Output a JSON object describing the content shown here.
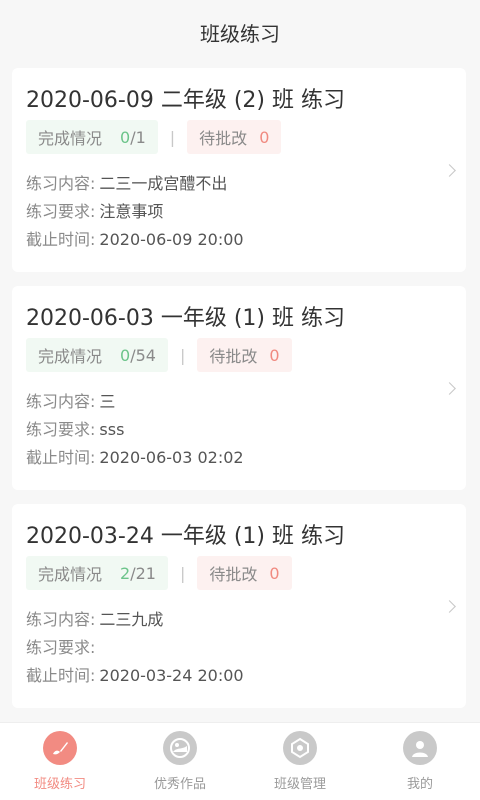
{
  "header": {
    "title": "班级练习"
  },
  "cards": [
    {
      "title": "2020-06-09 二年级 (2) 班 练习",
      "done_label": "完成情况",
      "done_count": "0",
      "done_total": "/1",
      "pending_label": "待批改",
      "pending_count": "0",
      "content_label": "练习内容:",
      "content_value": "二三一成宫醴不出",
      "require_label": "练习要求:",
      "require_value": "注意事项",
      "deadline_label": "截止时间:",
      "deadline_value": "2020-06-09 20:00"
    },
    {
      "title": "2020-06-03 一年级 (1) 班 练习",
      "done_label": "完成情况",
      "done_count": "0",
      "done_total": "/54",
      "pending_label": "待批改",
      "pending_count": "0",
      "content_label": "练习内容:",
      "content_value": "三",
      "require_label": "练习要求:",
      "require_value": "sss",
      "deadline_label": "截止时间:",
      "deadline_value": "2020-06-03 02:02"
    },
    {
      "title": "2020-03-24 一年级 (1) 班 练习",
      "done_label": "完成情况",
      "done_count": "2",
      "done_total": "/21",
      "pending_label": "待批改",
      "pending_count": "0",
      "content_label": "练习内容:",
      "content_value": "二三九成",
      "require_label": "练习要求:",
      "require_value": "",
      "deadline_label": "截止时间:",
      "deadline_value": "2020-03-24 20:00"
    }
  ],
  "separator": "|",
  "tabs": [
    {
      "label": "班级练习",
      "icon": "brush-icon",
      "active": true
    },
    {
      "label": "优秀作品",
      "icon": "gallery-icon",
      "active": false
    },
    {
      "label": "班级管理",
      "icon": "class-manage-icon",
      "active": false
    },
    {
      "label": "我的",
      "icon": "profile-icon",
      "active": false
    }
  ],
  "colors": {
    "accent": "#f28b82",
    "green": "#6cc48a",
    "red": "#f08a80"
  }
}
